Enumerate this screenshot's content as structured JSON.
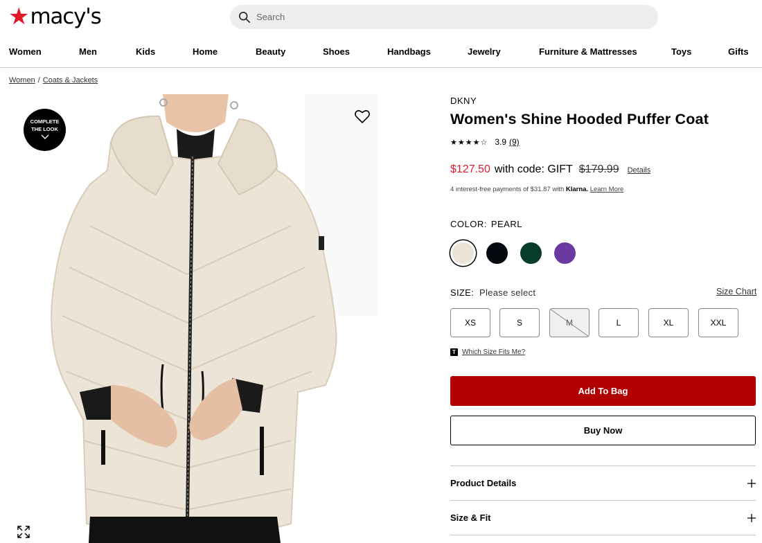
{
  "header": {
    "logo_text": "macy's",
    "search_placeholder": "Search"
  },
  "nav": [
    {
      "label": "Women"
    },
    {
      "label": "Men"
    },
    {
      "label": "Kids"
    },
    {
      "label": "Home"
    },
    {
      "label": "Beauty"
    },
    {
      "label": "Shoes"
    },
    {
      "label": "Handbags"
    },
    {
      "label": "Jewelry"
    },
    {
      "label": "Furniture & Mattresses"
    },
    {
      "label": "Toys"
    },
    {
      "label": "Gifts"
    }
  ],
  "breadcrumb": [
    "Women",
    "Coats & Jackets"
  ],
  "image": {
    "complete_look_line1": "COMPLETE",
    "complete_look_line2": "THE LOOK",
    "coat_color": "#ece4d6"
  },
  "product": {
    "brand": "DKNY",
    "title": "Women's Shine Hooded Puffer Coat",
    "stars": "★★★★☆",
    "rating": "3.9",
    "review_count": "(9)",
    "sale_price": "$127.50",
    "code_text": "with code: GIFT",
    "original_price": "$179.99",
    "details_link": "Details",
    "klarna_text": "4 interest-free payments of $31.87 with",
    "klarna_brand": "Klarna.",
    "klarna_link": "Learn More",
    "color_label": "COLOR:",
    "color_value": "PEARL",
    "swatches": [
      {
        "name": "pearl",
        "hex": "#ece4d6",
        "selected": true
      },
      {
        "name": "black",
        "hex": "#050a10"
      },
      {
        "name": "green",
        "hex": "#083d2c"
      },
      {
        "name": "purple",
        "hex": "#6a3aa0"
      }
    ],
    "size_label": "SIZE:",
    "size_value": "Please select",
    "size_chart_link": "Size Chart",
    "sizes": [
      {
        "label": "XS"
      },
      {
        "label": "S"
      },
      {
        "label": "M",
        "unavailable": true
      },
      {
        "label": "L"
      },
      {
        "label": "XL"
      },
      {
        "label": "XXL"
      }
    ],
    "fit_icon_letter": "T",
    "fit_link": "Which Size Fits Me?",
    "add_to_bag": "Add To Bag",
    "buy_now": "Buy Now",
    "accordions": [
      {
        "label": "Product Details"
      },
      {
        "label": "Size & Fit"
      }
    ]
  },
  "colors": {
    "brand_red": "#e11a2b",
    "add_to_bag_bg": "#b20000"
  }
}
